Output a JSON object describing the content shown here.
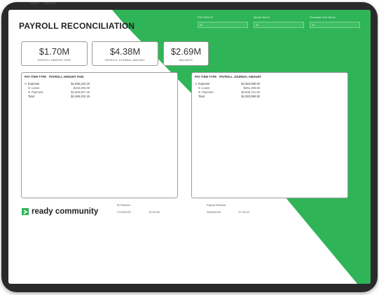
{
  "report": {
    "title": "PAYROLL RECONCILIATION",
    "accent_color": "#2fb457"
  },
  "filters": [
    {
      "label": "PAY RUN ID",
      "value": "All"
    },
    {
      "label": "Month Name",
      "value": "All"
    },
    {
      "label": "Financial Year Name",
      "value": "All"
    }
  ],
  "kpis": [
    {
      "value": "$1.70M",
      "label": "PAYROLL AMOUNT PAID"
    },
    {
      "value": "$4.38M",
      "label": "PAYROLL JOURNAL AMOUNT"
    },
    {
      "value": "$2.69M",
      "label": "BALANCE"
    }
  ],
  "table_left": {
    "columns": [
      "PAY ITEM TYPE",
      "PAYROLL AMOUNT PAID"
    ],
    "rows": [
      {
        "label": "Expense",
        "value": "$1,695,232.19",
        "expander": "⊟"
      },
      {
        "label": "Leave",
        "value": "$194,305.00",
        "expander": "⊞"
      },
      {
        "label": "Payment",
        "value": "$1,500,927.19",
        "expander": "⊞"
      },
      {
        "label": "Total",
        "value": "$1,695,232.19",
        "expander": ""
      }
    ]
  },
  "table_right": {
    "columns": [
      "PAY ITEM TYPE",
      "PAYROLL JOURNAL AMOUNT"
    ],
    "rows": [
      {
        "label": "Expense",
        "value": "$4,383,090.92",
        "expander": "⊟"
      },
      {
        "label": "Leave",
        "value": "$461,368.60",
        "expander": "⊞"
      },
      {
        "label": "Payment",
        "value": "$3,935,721.02",
        "expander": "⊞"
      },
      {
        "label": "Total",
        "value": "$4,383,090.92",
        "expander": ""
      }
    ]
  },
  "footer": {
    "brand": "ready community",
    "refresh_left": {
      "label": "BI Refresh",
      "date": "27/05/2022",
      "time": "15:31:06"
    },
    "refresh_right": {
      "label": "Payroll Refresh",
      "date": "08/05/2023",
      "time": "07:02:43"
    }
  }
}
